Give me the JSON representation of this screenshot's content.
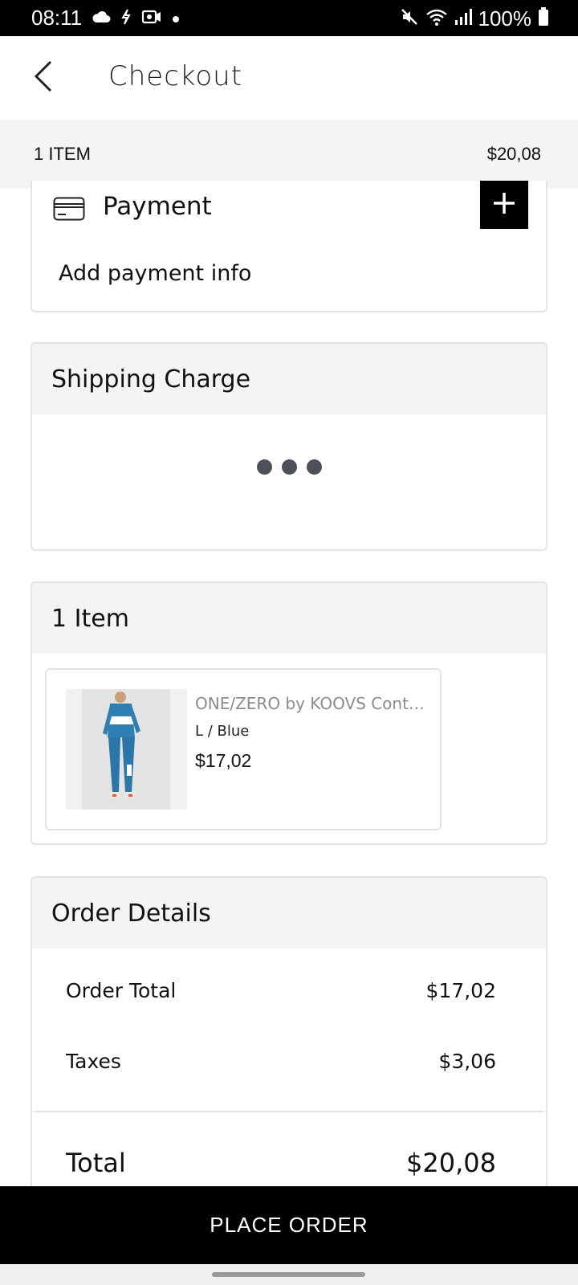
{
  "status_bar": {
    "time": "08:11",
    "battery": "100%",
    "left_icons": [
      "cloud-icon",
      "sync-icon",
      "recorder-icon",
      "dot-icon"
    ],
    "right_icons": [
      "mute-icon",
      "wifi-icon",
      "signal-icon",
      "battery-icon"
    ]
  },
  "header": {
    "title": "Checkout",
    "back_icon": "chevron-left-icon"
  },
  "summary": {
    "count": "1 ITEM",
    "price": "$20,08"
  },
  "payment": {
    "title": "Payment",
    "info": "Add payment info",
    "icon": "credit-card-icon",
    "add_icon": "plus-icon"
  },
  "shipping": {
    "title": "Shipping Charge"
  },
  "items": {
    "title": "1 Item",
    "products": [
      {
        "name": "ONE/ZERO by KOOVS Contra...",
        "variant": "L / Blue",
        "price": "$17,02"
      }
    ]
  },
  "order_details": {
    "title": "Order Details",
    "order_total_label": "Order Total",
    "order_total_value": "$17,02",
    "taxes_label": "Taxes",
    "taxes_value": "$3,06",
    "total_label": "Total",
    "total_value": "$20,08"
  },
  "actions": {
    "place_order": "PLACE ORDER"
  },
  "colors": {
    "accent": "#000000",
    "panel_bg": "#f3f4f6",
    "border": "#e3e3e5",
    "loader": "#4b5059"
  }
}
